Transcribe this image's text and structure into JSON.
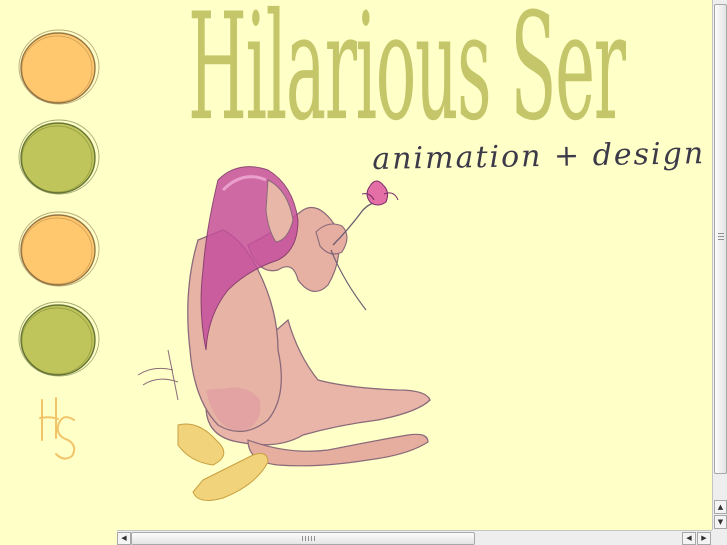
{
  "header": {
    "title": "Hilarious Ser",
    "tagline": "animation + design by"
  },
  "nav": {
    "circles": [
      {
        "color": "#ffc86e",
        "stroke": "#7a5a30"
      },
      {
        "color": "#bfc55a",
        "stroke": "#4a5a20"
      },
      {
        "color": "#ffc86e",
        "stroke": "#7a5a30"
      },
      {
        "color": "#bfc55a",
        "stroke": "#4a5a20"
      }
    ]
  },
  "logo": {
    "monogram": "HS"
  },
  "colors": {
    "background": "#ffffc8",
    "title": "#c5c66a",
    "tagline": "#3c3a48",
    "orange": "#ffc86e",
    "green": "#bfc55a",
    "monogram": "#f2c469"
  },
  "scrollbars": {
    "up_icon": "▲",
    "down_icon": "▼",
    "left_icon": "◀",
    "right_icon": "▶"
  }
}
